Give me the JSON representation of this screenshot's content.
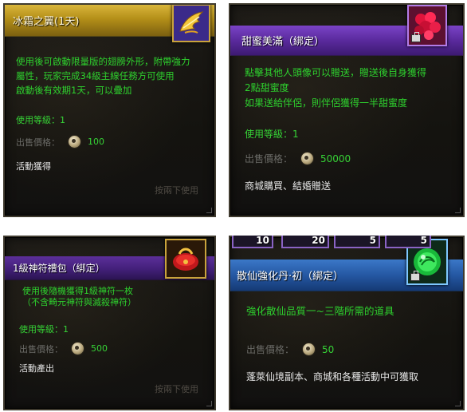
{
  "cards": [
    {
      "title": "冰霜之翼(1天)",
      "icon": "frost-wings-icon",
      "description": [
        "使用後可啟動限量版的翅膀外形，附帶強力",
        "屬性，玩家完成34級主線任務方可使用",
        "啟動後有效期1天，可以疊加"
      ],
      "level_text": "使用等級：1",
      "price_label": "出售價格：",
      "price_value": "100",
      "source": "活動獲得",
      "hint": "按兩下使用"
    },
    {
      "title": "甜蜜美滿（綁定）",
      "icon": "red-hearts-icon",
      "description": [
        "點擊其他人頭像可以贈送，贈送後自身獲得",
        "2點甜蜜度",
        "如果送給伴侶，則伴侶獲得一半甜蜜度"
      ],
      "level_text": "使用等級：1",
      "price_label": "出售價格：",
      "price_value": "50000",
      "source": "商城購買、結婚贈送",
      "hint": ""
    },
    {
      "title": "1級神符禮包（綁定）",
      "icon": "red-gift-pouch-icon",
      "description": [
        "使用後隨機獲得1級神符一枚",
        "（不含畸元神符與滅殺神符）"
      ],
      "level_text": "使用等級：1",
      "price_label": "出售價格：",
      "price_value": "500",
      "source": "活動產出",
      "hint": "按兩下使用"
    },
    {
      "title": "散仙強化丹·初（綁定）",
      "icon": "green-orb-icon",
      "description": [
        "強化散仙品質一~三階所需的道具"
      ],
      "level_text": "",
      "price_label": "出售價格：",
      "price_value": "50",
      "source": "蓬萊仙境副本、商城和各種活動中可獲取",
      "hint": ""
    }
  ],
  "slot_bar": [
    "10",
    "20",
    "5",
    "5"
  ],
  "colors": {
    "gold_header": "#c9a227",
    "purple_header": "#6a35b0",
    "blue_header": "#2a62ae",
    "green_text": "#36d236",
    "grey_text": "#6a6a66"
  }
}
